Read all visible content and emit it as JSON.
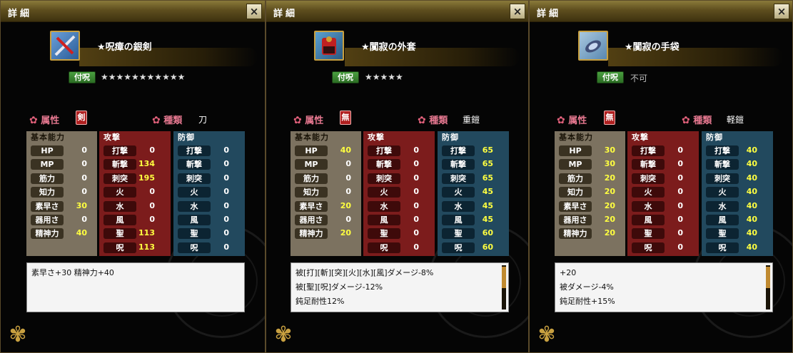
{
  "panels": [
    {
      "title": "詳細",
      "item_name": "★呪瘴の銀剣",
      "enchant_label": "付呪",
      "enchant_value": "★★★★★★★★★★★",
      "attr_label": "属性",
      "attr_value": "剣",
      "kind_label": "種類",
      "kind_value": "刀",
      "basic_header": "基本能力",
      "attack_header": "攻撃",
      "defense_header": "防御",
      "basic": [
        {
          "label": "HP",
          "value": "0",
          "hl": false
        },
        {
          "label": "MP",
          "value": "0",
          "hl": false
        },
        {
          "label": "筋力",
          "value": "0",
          "hl": false
        },
        {
          "label": "知力",
          "value": "0",
          "hl": false
        },
        {
          "label": "素早さ",
          "value": "30",
          "hl": true
        },
        {
          "label": "器用さ",
          "value": "0",
          "hl": false
        },
        {
          "label": "精神力",
          "value": "40",
          "hl": true
        }
      ],
      "attack": [
        {
          "label": "打撃",
          "value": "0",
          "hl": false
        },
        {
          "label": "斬撃",
          "value": "134",
          "hl": true
        },
        {
          "label": "刺突",
          "value": "195",
          "hl": true
        },
        {
          "label": "火",
          "value": "0",
          "hl": false
        },
        {
          "label": "水",
          "value": "0",
          "hl": false
        },
        {
          "label": "風",
          "value": "0",
          "hl": false
        },
        {
          "label": "聖",
          "value": "113",
          "hl": true
        },
        {
          "label": "呪",
          "value": "113",
          "hl": true
        }
      ],
      "defense": [
        {
          "label": "打撃",
          "value": "0",
          "hl": false
        },
        {
          "label": "斬撃",
          "value": "0",
          "hl": false
        },
        {
          "label": "刺突",
          "value": "0",
          "hl": false
        },
        {
          "label": "火",
          "value": "0",
          "hl": false
        },
        {
          "label": "水",
          "value": "0",
          "hl": false
        },
        {
          "label": "風",
          "value": "0",
          "hl": false
        },
        {
          "label": "聖",
          "value": "0",
          "hl": false
        },
        {
          "label": "呪",
          "value": "0",
          "hl": false
        }
      ],
      "desc_lines": [
        "素早さ+30 精神力+40"
      ]
    },
    {
      "title": "詳細",
      "item_name": "★闃寂の外套",
      "enchant_label": "付呪",
      "enchant_value": "★★★★★",
      "attr_label": "属性",
      "attr_value": "無",
      "kind_label": "種類",
      "kind_value": "重鎧",
      "basic_header": "基本能力",
      "attack_header": "攻撃",
      "defense_header": "防御",
      "basic": [
        {
          "label": "HP",
          "value": "40",
          "hl": true
        },
        {
          "label": "MP",
          "value": "0",
          "hl": false
        },
        {
          "label": "筋力",
          "value": "0",
          "hl": false
        },
        {
          "label": "知力",
          "value": "0",
          "hl": false
        },
        {
          "label": "素早さ",
          "value": "20",
          "hl": true
        },
        {
          "label": "器用さ",
          "value": "0",
          "hl": false
        },
        {
          "label": "精神力",
          "value": "20",
          "hl": true
        }
      ],
      "attack": [
        {
          "label": "打撃",
          "value": "0",
          "hl": false
        },
        {
          "label": "斬撃",
          "value": "0",
          "hl": false
        },
        {
          "label": "刺突",
          "value": "0",
          "hl": false
        },
        {
          "label": "火",
          "value": "0",
          "hl": false
        },
        {
          "label": "水",
          "value": "0",
          "hl": false
        },
        {
          "label": "風",
          "value": "0",
          "hl": false
        },
        {
          "label": "聖",
          "value": "0",
          "hl": false
        },
        {
          "label": "呪",
          "value": "0",
          "hl": false
        }
      ],
      "defense": [
        {
          "label": "打撃",
          "value": "65",
          "hl": true
        },
        {
          "label": "斬撃",
          "value": "65",
          "hl": true
        },
        {
          "label": "刺突",
          "value": "65",
          "hl": true
        },
        {
          "label": "火",
          "value": "45",
          "hl": true
        },
        {
          "label": "水",
          "value": "45",
          "hl": true
        },
        {
          "label": "風",
          "value": "45",
          "hl": true
        },
        {
          "label": "聖",
          "value": "60",
          "hl": true
        },
        {
          "label": "呪",
          "value": "60",
          "hl": true
        }
      ],
      "desc_lines": [
        "被[打][斬][突][火][水][風]ダメージ-8%",
        "被[聖][呪]ダメージ-12%",
        "鈍足耐性12%"
      ]
    },
    {
      "title": "詳細",
      "item_name": "★闃寂の手袋",
      "enchant_label": "付呪",
      "enchant_value": "不可",
      "attr_label": "属性",
      "attr_value": "無",
      "kind_label": "種類",
      "kind_value": "軽鎧",
      "basic_header": "基本能力",
      "attack_header": "攻撃",
      "defense_header": "防御",
      "basic": [
        {
          "label": "HP",
          "value": "30",
          "hl": true
        },
        {
          "label": "MP",
          "value": "30",
          "hl": true
        },
        {
          "label": "筋力",
          "value": "20",
          "hl": true
        },
        {
          "label": "知力",
          "value": "20",
          "hl": true
        },
        {
          "label": "素早さ",
          "value": "20",
          "hl": true
        },
        {
          "label": "器用さ",
          "value": "20",
          "hl": true
        },
        {
          "label": "精神力",
          "value": "20",
          "hl": true
        }
      ],
      "attack": [
        {
          "label": "打撃",
          "value": "0",
          "hl": false
        },
        {
          "label": "斬撃",
          "value": "0",
          "hl": false
        },
        {
          "label": "刺突",
          "value": "0",
          "hl": false
        },
        {
          "label": "火",
          "value": "0",
          "hl": false
        },
        {
          "label": "水",
          "value": "0",
          "hl": false
        },
        {
          "label": "風",
          "value": "0",
          "hl": false
        },
        {
          "label": "聖",
          "value": "0",
          "hl": false
        },
        {
          "label": "呪",
          "value": "0",
          "hl": false
        }
      ],
      "defense": [
        {
          "label": "打撃",
          "value": "40",
          "hl": true
        },
        {
          "label": "斬撃",
          "value": "40",
          "hl": true
        },
        {
          "label": "刺突",
          "value": "40",
          "hl": true
        },
        {
          "label": "火",
          "value": "40",
          "hl": true
        },
        {
          "label": "水",
          "value": "40",
          "hl": true
        },
        {
          "label": "風",
          "value": "40",
          "hl": true
        },
        {
          "label": "聖",
          "value": "40",
          "hl": true
        },
        {
          "label": "呪",
          "value": "40",
          "hl": true
        }
      ],
      "desc_lines": [
        "+20",
        "被ダメージ-4%",
        "鈍足耐性+15%"
      ]
    }
  ],
  "icons": {
    "close": "×",
    "sakura": "✿"
  }
}
